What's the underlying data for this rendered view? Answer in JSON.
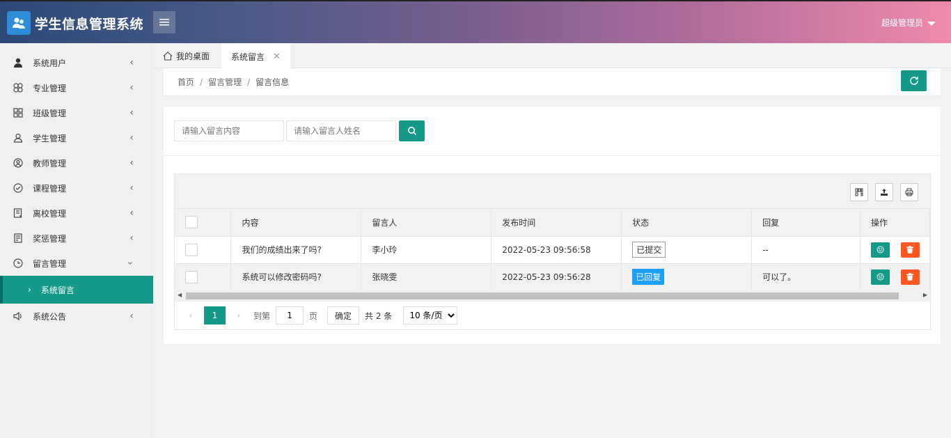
{
  "app": {
    "title": "学生信息管理系统",
    "user": "超级管理员"
  },
  "sidebar": {
    "items": [
      {
        "label": "系统用户"
      },
      {
        "label": "专业管理"
      },
      {
        "label": "班级管理"
      },
      {
        "label": "学生管理"
      },
      {
        "label": "教师管理"
      },
      {
        "label": "课程管理"
      },
      {
        "label": "离校管理"
      },
      {
        "label": "奖惩管理"
      },
      {
        "label": "留言管理"
      },
      {
        "label": "系统公告"
      }
    ],
    "sub_active": "系统留言"
  },
  "tabs": {
    "home": "我的桌面",
    "active": "系统留言"
  },
  "breadcrumb": {
    "a": "首页",
    "b": "留言管理",
    "c": "留言信息"
  },
  "search": {
    "content_placeholder": "请输入留言内容",
    "name_placeholder": "请输入留言人姓名"
  },
  "table": {
    "headers": {
      "content": "内容",
      "author": "留言人",
      "time": "发布时间",
      "status": "状态",
      "reply": "回复",
      "ops": "操作"
    },
    "rows": [
      {
        "content": "我们的成绩出来了吗?",
        "author": "李小玲",
        "time": "2022-05-23 09:56:58",
        "status": "已提交",
        "reply": "--"
      },
      {
        "content": "系统可以修改密码吗?",
        "author": "张晓雯",
        "time": "2022-05-23 09:56:28",
        "status": "已回复",
        "reply": "可以了。"
      }
    ]
  },
  "pager": {
    "current": "1",
    "goto_label": "到第",
    "page_value": "1",
    "page_unit": "页",
    "confirm": "确定",
    "total": "共 2 条",
    "page_size": "10 条/页"
  },
  "colors": {
    "accent": "#159a8a",
    "danger": "#ff5722",
    "info": "#1E9FFF"
  }
}
